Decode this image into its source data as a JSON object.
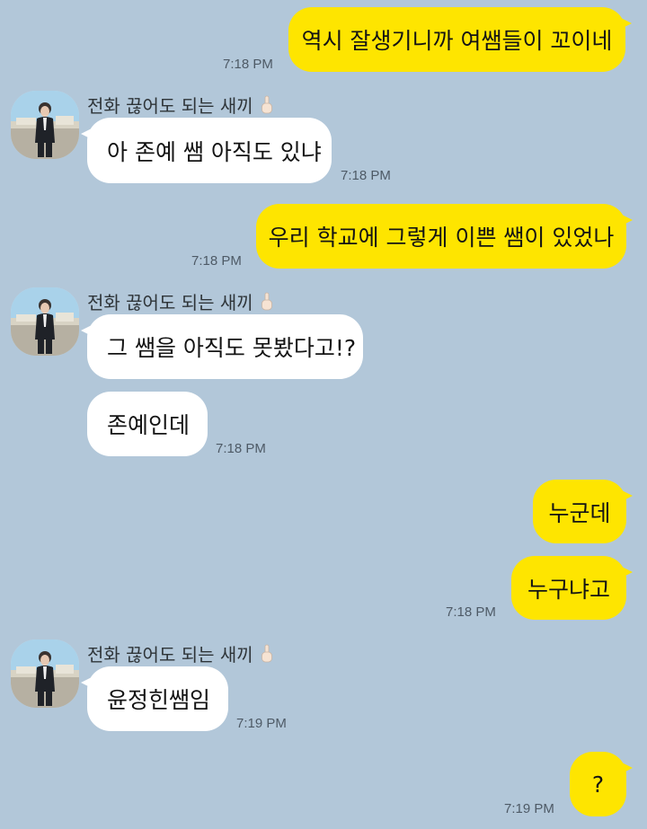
{
  "contact": {
    "name": "전화 끊어도 되는 새끼",
    "name_emoji": "middle-finger-icon"
  },
  "messages": [
    {
      "side": "me",
      "text": "역시 잘생기니까 여쌤들이 꼬이네",
      "time": "7:18 PM"
    },
    {
      "side": "them",
      "text": "아 존예 쌤 아직도 있냐",
      "time": "7:18 PM"
    },
    {
      "side": "me",
      "text": "우리 학교에 그렇게 이쁜 쌤이 있었나",
      "time": "7:18 PM"
    },
    {
      "side": "them",
      "text": "그 쌤을 아직도 못봤다고!?"
    },
    {
      "side": "them",
      "text": "존예인데",
      "time": "7:18 PM"
    },
    {
      "side": "me",
      "text": "누군데"
    },
    {
      "side": "me",
      "text": "누구냐고",
      "time": "7:18 PM"
    },
    {
      "side": "them",
      "text": "윤정힌쌤임",
      "time": "7:19 PM"
    },
    {
      "side": "me",
      "text": "?",
      "time": "7:19 PM"
    }
  ],
  "colors": {
    "background": "#b2c7d9",
    "my_bubble": "#fee500",
    "their_bubble": "#ffffff",
    "timestamp": "#4e5a66"
  }
}
